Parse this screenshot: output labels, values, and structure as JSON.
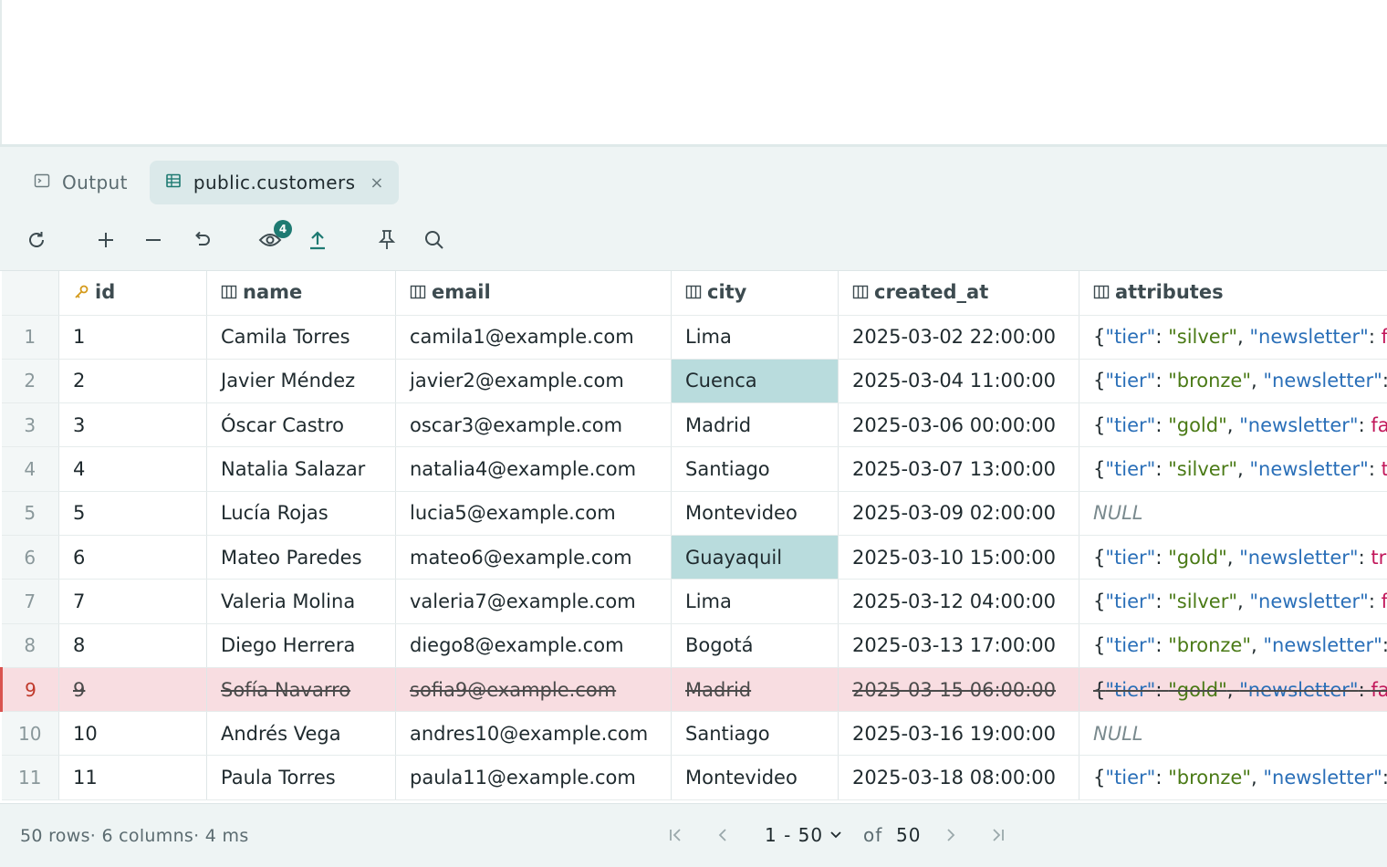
{
  "tabs": [
    {
      "label": "Output",
      "icon": "terminal-icon",
      "active": false
    },
    {
      "label": "public.customers",
      "icon": "table-icon",
      "active": true,
      "close": "×"
    }
  ],
  "toolbar": {
    "items": [
      "refresh-icon",
      "add-row-icon",
      "delete-row-icon",
      "revert-icon",
      "preview-changes-icon",
      "submit-icon",
      "pin-icon",
      "search-icon"
    ],
    "pending_changes": "4"
  },
  "columns": [
    {
      "name": "id",
      "icon": "key-icon"
    },
    {
      "name": "name",
      "icon": "column-icon"
    },
    {
      "name": "email",
      "icon": "column-icon"
    },
    {
      "name": "city",
      "icon": "column-icon"
    },
    {
      "name": "created_at",
      "icon": "column-icon"
    },
    {
      "name": "attributes",
      "icon": "column-icon"
    }
  ],
  "rows": [
    {
      "n": "1",
      "id": "1",
      "name": "Camila Torres",
      "email": "camila1@example.com",
      "city": "Lima",
      "created_at": "2025-03-02 22:00:00",
      "attr": {
        "tier": "silver",
        "newsletter": "fa"
      }
    },
    {
      "n": "2",
      "id": "2",
      "name": "Javier Méndez",
      "email": "javier2@example.com",
      "city": "Cuenca",
      "city_edited": true,
      "created_at": "2025-03-04 11:00:00",
      "attr": {
        "tier": "bronze",
        "newsletter": ""
      }
    },
    {
      "n": "3",
      "id": "3",
      "name": "Óscar Castro",
      "email": "oscar3@example.com",
      "city": "Madrid",
      "created_at": "2025-03-06 00:00:00",
      "attr": {
        "tier": "gold",
        "newsletter": "fa"
      }
    },
    {
      "n": "4",
      "id": "4",
      "name": "Natalia Salazar",
      "email": "natalia4@example.com",
      "city": "Santiago",
      "created_at": "2025-03-07 13:00:00",
      "attr": {
        "tier": "silver",
        "newsletter": "tr"
      }
    },
    {
      "n": "5",
      "id": "5",
      "name": "Lucía Rojas",
      "email": "lucia5@example.com",
      "city": "Montevideo",
      "created_at": "2025-03-09 02:00:00",
      "attr": null
    },
    {
      "n": "6",
      "id": "6",
      "name": "Mateo Paredes",
      "email": "mateo6@example.com",
      "city": "Guayaquil",
      "city_edited": true,
      "created_at": "2025-03-10 15:00:00",
      "attr": {
        "tier": "gold",
        "newsletter": "tru"
      }
    },
    {
      "n": "7",
      "id": "7",
      "name": "Valeria Molina",
      "email": "valeria7@example.com",
      "city": "Lima",
      "created_at": "2025-03-12 04:00:00",
      "attr": {
        "tier": "silver",
        "newsletter": "fa"
      }
    },
    {
      "n": "8",
      "id": "8",
      "name": "Diego Herrera",
      "email": "diego8@example.com",
      "city": "Bogotá",
      "created_at": "2025-03-13 17:00:00",
      "attr": {
        "tier": "bronze",
        "newsletter": ""
      }
    },
    {
      "n": "9",
      "id": "9",
      "name": "Sofía Navarro",
      "email": "sofia9@example.com",
      "city": "Madrid",
      "created_at": "2025-03-15 06:00:00",
      "attr": {
        "tier": "gold",
        "newsletter": "fa"
      },
      "deleted": true
    },
    {
      "n": "10",
      "id": "10",
      "name": "Andrés Vega",
      "email": "andres10@example.com",
      "city": "Santiago",
      "created_at": "2025-03-16 19:00:00",
      "attr": null
    },
    {
      "n": "11",
      "id": "11",
      "name": "Paula Torres",
      "email": "paula11@example.com",
      "city": "Montevideo",
      "created_at": "2025-03-18 08:00:00",
      "attr": {
        "tier": "bronze",
        "newsletter": ""
      }
    }
  ],
  "null_label": "NULL",
  "footer": {
    "status": "50 rows· 6 columns· 4 ms",
    "range": "1 - 50",
    "of_label": "of",
    "total": "50"
  },
  "colors": {
    "accent": "#1e7a72",
    "edited_cell": "#b9dcdd",
    "deleted_row": "#f8dde1",
    "json_key": "#2a6fb8",
    "json_string": "#4a7a16",
    "json_bool": "#c2185b"
  }
}
